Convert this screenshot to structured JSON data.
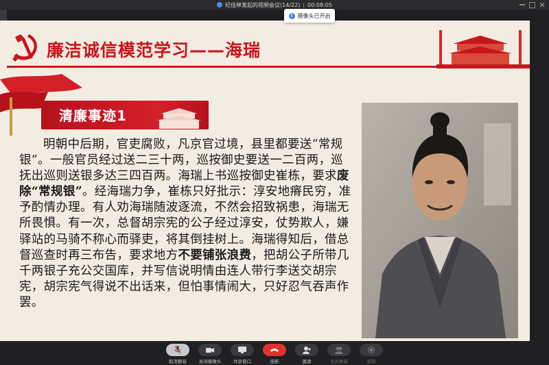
{
  "window": {
    "title": "纪佳林发起的视频会议(14/22)",
    "duration": "00:08:05"
  },
  "toast": {
    "text": "摄像头已开启"
  },
  "slide": {
    "title": "廉洁诚信模范学习——海瑞",
    "section_label": "清廉事迹1",
    "body": {
      "p1": "明朝中后期，官吏腐败，凡京官过境，县里都要送“常规银”。一般官员经过送二三十两，巡按御史要送一二百两，巡抚出巡则送银多达三四百两。海瑞上书巡按御史崔栋，要求",
      "em1": "废除“常规银”",
      "p2": "。经海瑞力争，崔栋只好批示：淳安地瘠民穷，准予酌情办理。有人劝海瑞随波逐流，不然会招致祸患，海瑞无所畏惧。有一次，总督胡宗宪的公子经过淳安，仗势欺人，嫌驿站的马骑不称心而驿吏，将其倒挂树上。海瑞得知后，借总督巡查时再三布告，要求地方",
      "em2": "不要铺张浪费",
      "p3": "，把胡公子所带几千两银子充公交国库，并写信说明情由连人带行李送交胡宗宪，胡宗宪气得说不出话来，但怕事情闹大，只好忍气吞声作罢。"
    }
  },
  "toolbar": {
    "buttons": [
      {
        "label": "取消静音",
        "icon": "microphone-icon"
      },
      {
        "label": "关闭摄像头",
        "icon": "camera-icon"
      },
      {
        "label": "共享窗口",
        "icon": "share-screen-icon"
      },
      {
        "label": "挂断",
        "icon": "hang-up-icon"
      },
      {
        "label": "邀请",
        "icon": "invite-icon"
      },
      {
        "label": "全员静音",
        "icon": "mute-all-icon"
      },
      {
        "label": "录制",
        "icon": "record-icon"
      }
    ]
  },
  "colors": {
    "accent_red": "#c8161d",
    "slide_bg": "#f3ece2",
    "hangup_red": "#e0332e"
  }
}
